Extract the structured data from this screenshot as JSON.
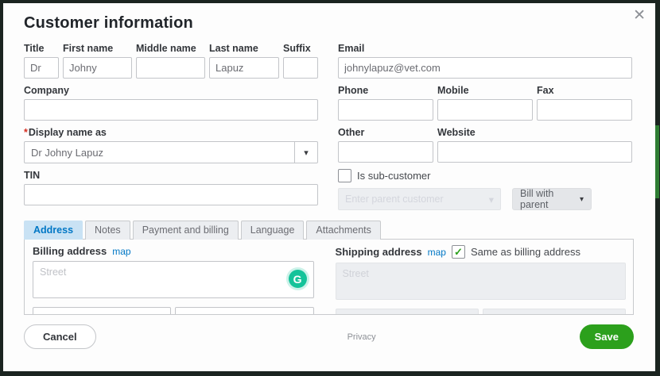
{
  "window": {
    "title": "Customer information"
  },
  "icons": {
    "close": "✕",
    "caret": "▾",
    "check": "✓",
    "grammarly": "G"
  },
  "form": {
    "title": {
      "label": "Title",
      "value": "Dr"
    },
    "first_name": {
      "label": "First name",
      "value": "Johny"
    },
    "middle_name": {
      "label": "Middle name",
      "value": ""
    },
    "last_name": {
      "label": "Last name",
      "value": "Lapuz"
    },
    "suffix": {
      "label": "Suffix",
      "value": ""
    },
    "email": {
      "label": "Email",
      "value": "johnylapuz@vet.com"
    },
    "company": {
      "label": "Company",
      "value": ""
    },
    "phone": {
      "label": "Phone",
      "value": ""
    },
    "mobile": {
      "label": "Mobile",
      "value": ""
    },
    "fax": {
      "label": "Fax",
      "value": ""
    },
    "display_name": {
      "required_mark": "*",
      "label": "Display name as",
      "value": "Dr Johny Lapuz"
    },
    "other": {
      "label": "Other",
      "value": ""
    },
    "website": {
      "label": "Website",
      "value": ""
    },
    "tin": {
      "label": "TIN",
      "value": ""
    },
    "is_sub_customer": {
      "label": "Is sub-customer",
      "checked": false
    },
    "parent_customer": {
      "placeholder": "Enter parent customer",
      "disabled": true
    },
    "bill_with_parent": {
      "value": "Bill with parent",
      "disabled": true
    }
  },
  "tabs": [
    {
      "label": "Address",
      "active": true
    },
    {
      "label": "Notes",
      "active": false
    },
    {
      "label": "Payment and billing",
      "active": false
    },
    {
      "label": "Language",
      "active": false
    },
    {
      "label": "Attachments",
      "active": false
    }
  ],
  "address": {
    "billing": {
      "label": "Billing address",
      "map_label": "map",
      "street_placeholder": "Street"
    },
    "shipping": {
      "label": "Shipping address",
      "map_label": "map",
      "street_placeholder": "Street",
      "same_as_billing_label": "Same as billing address",
      "same_as_billing_checked": true
    }
  },
  "footer": {
    "cancel_label": "Cancel",
    "privacy_label": "Privacy",
    "save_label": "Save"
  },
  "colors": {
    "accent_green": "#2ca01c",
    "link_blue": "#0077c5",
    "active_tab_bg": "#c9e2f4",
    "grammarly_green": "#15c39a",
    "required_red": "#d52b1e",
    "frame_dark": "#1b2420"
  }
}
